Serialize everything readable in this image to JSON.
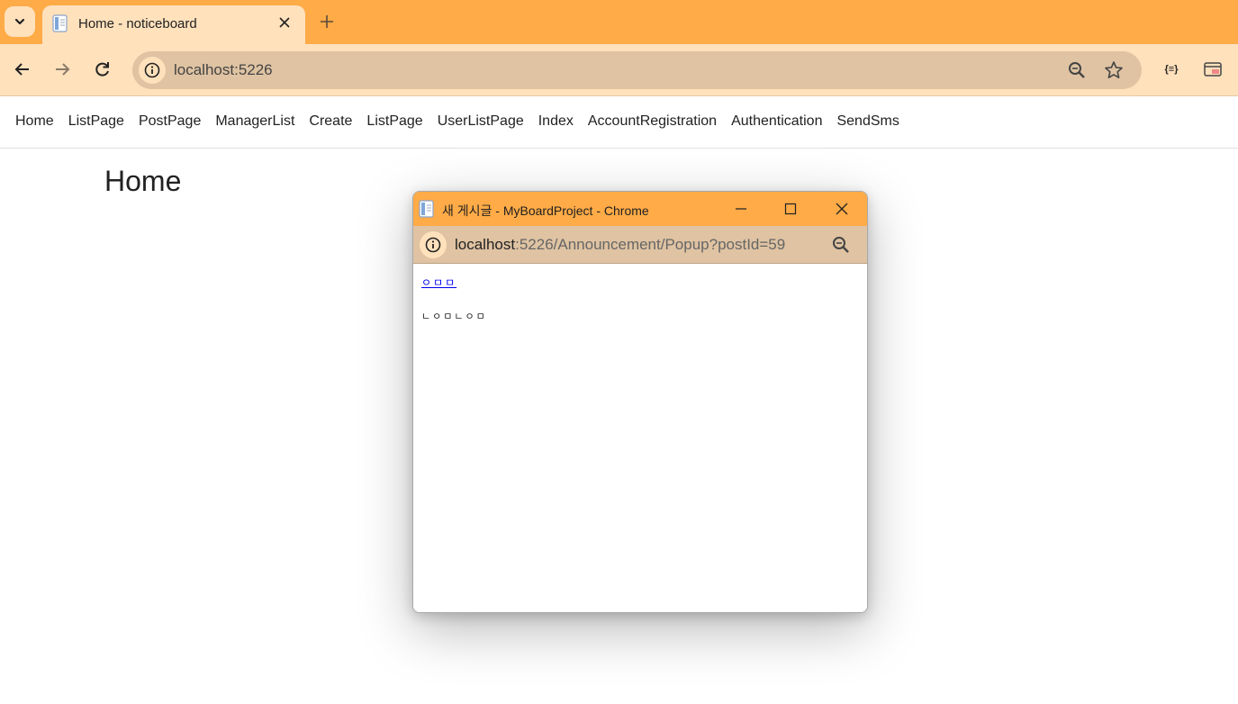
{
  "browser": {
    "tab_title": "Home - noticeboard",
    "url": "localhost:5226"
  },
  "site": {
    "nav": [
      "Home",
      "ListPage",
      "PostPage",
      "ManagerList",
      "Create",
      "ListPage",
      "UserListPage",
      "Index",
      "AccountRegistration",
      "Authentication",
      "SendSms"
    ],
    "heading": "Home"
  },
  "popup": {
    "title": "새 게시글 - MyBoardProject - Chrome",
    "url_host": "localhost",
    "url_rest": ":5226/Announcement/Popup?postId=59",
    "post_title": "ㅇㅁㅁ",
    "post_body": "ㄴㅇㅁㄴㅇㅁ"
  },
  "colors": {
    "chrome_accent": "#ffab47",
    "chrome_light": "#ffe1bc",
    "omnibox": "#dfc3a2",
    "link": "#0000ee"
  }
}
